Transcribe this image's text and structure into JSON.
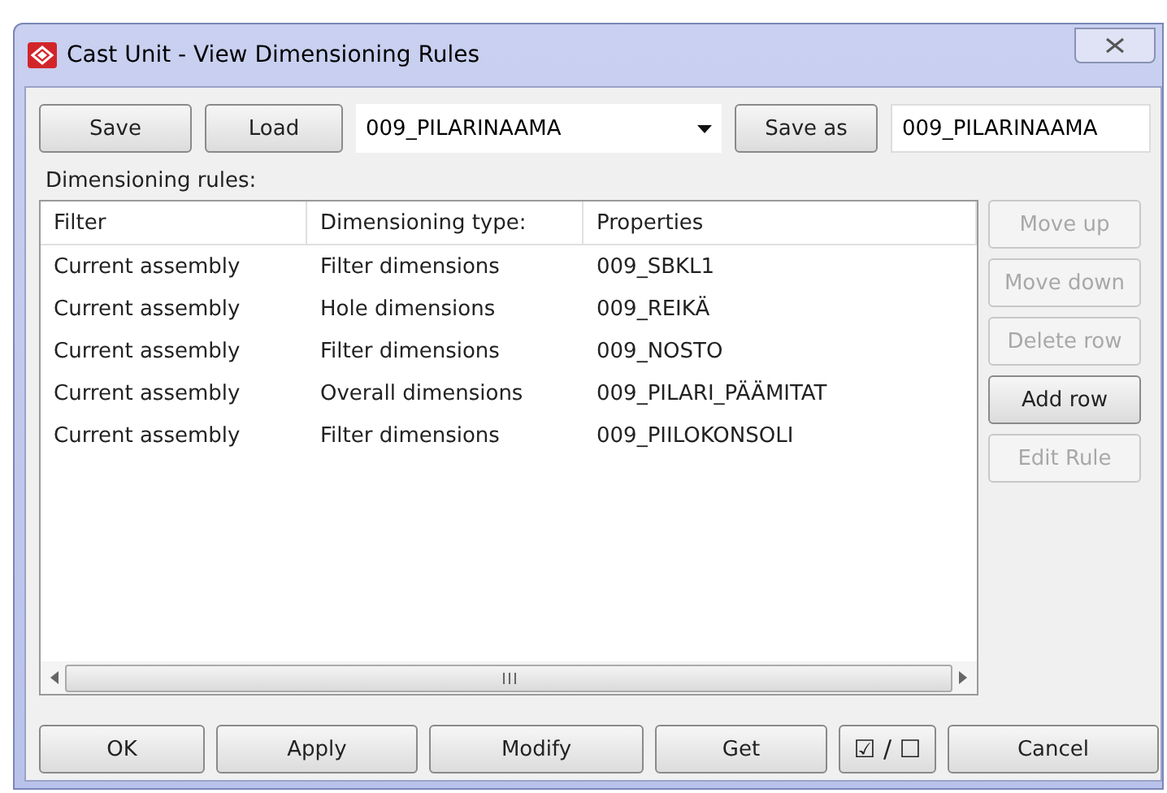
{
  "window": {
    "title": "Cast Unit - View Dimensioning Rules"
  },
  "toolbar": {
    "save": "Save",
    "load": "Load",
    "preset": "009_PILARINAAMA",
    "save_as": "Save as",
    "save_as_name": "009_PILARINAAMA"
  },
  "rules_label": "Dimensioning rules:",
  "table": {
    "columns": [
      "Filter",
      "Dimensioning type:",
      "Properties"
    ],
    "rows": [
      {
        "cells": [
          "Current assembly",
          "Filter dimensions",
          "009_SBKL1"
        ]
      },
      {
        "cells": [
          "Current assembly",
          "Hole dimensions",
          "009_REIKÄ"
        ]
      },
      {
        "cells": [
          "Current assembly",
          "Filter dimensions",
          "009_NOSTO"
        ]
      },
      {
        "cells": [
          "Current assembly",
          "Overall dimensions",
          "009_PILARI_PÄÄMITAT"
        ]
      },
      {
        "cells": [
          "Current assembly",
          "Filter dimensions",
          "009_PIILOKONSOLI"
        ]
      }
    ]
  },
  "side_buttons": [
    {
      "label": "Move up",
      "disabled": true
    },
    {
      "label": "Move down",
      "disabled": true
    },
    {
      "label": "Delete row",
      "disabled": true
    },
    {
      "label": "Add row",
      "disabled": false
    },
    {
      "label": "Edit Rule",
      "disabled": true
    }
  ],
  "bottom_buttons": [
    {
      "label": "OK",
      "kind": "text"
    },
    {
      "label": "Apply",
      "kind": "text"
    },
    {
      "label": "Modify",
      "kind": "text"
    },
    {
      "label": "Get",
      "kind": "text"
    },
    {
      "label": "☑ / ☐",
      "kind": "toggle"
    },
    {
      "label": "Cancel",
      "kind": "text"
    }
  ]
}
